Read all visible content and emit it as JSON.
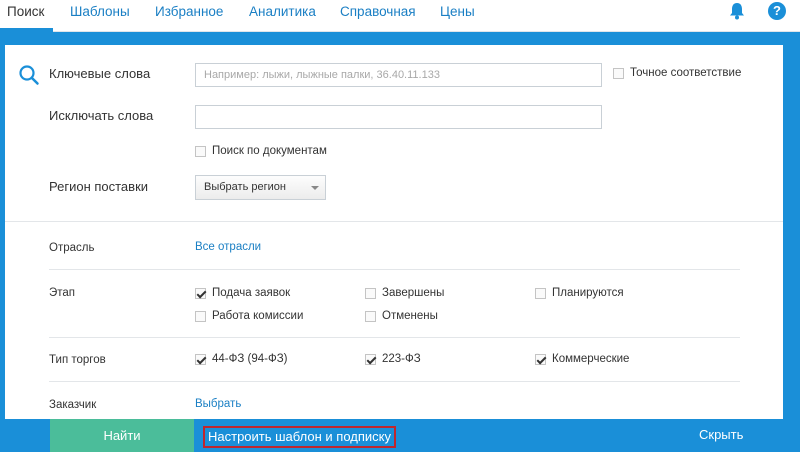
{
  "nav": {
    "tabs": [
      "Поиск",
      "Шаблоны",
      "Избранное",
      "Аналитика",
      "Справочная",
      "Цены"
    ],
    "help": "?",
    "icons": [
      "bell-icon",
      "help-icon"
    ]
  },
  "form": {
    "keywords_label": "Ключевые слова",
    "keywords_placeholder": "Например: лыжи, лыжные палки, 36.40.11.133",
    "keywords_value": "",
    "exact_match": "Точное соответствие",
    "exclude_label": "Исключать слова",
    "exclude_value": "",
    "doc_search": "Поиск по документам",
    "region_label": "Регион поставки",
    "region_select": "Выбрать регион"
  },
  "filters": {
    "industry_label": "Отрасль",
    "industry_link": "Все отрасли",
    "stage_label": "Этап",
    "stages": [
      {
        "label": "Подача заявок",
        "checked": true
      },
      {
        "label": "Завершены",
        "checked": false
      },
      {
        "label": "Планируются",
        "checked": false
      },
      {
        "label": "Работа комиссии",
        "checked": false
      },
      {
        "label": "Отменены",
        "checked": false
      }
    ],
    "type_label": "Тип торгов",
    "types": [
      {
        "label": "44-ФЗ (94-ФЗ)",
        "checked": true
      },
      {
        "label": "223-ФЗ",
        "checked": true
      },
      {
        "label": "Коммерческие",
        "checked": true
      }
    ],
    "customer_label": "Заказчик",
    "customer_link": "Выбрать"
  },
  "actions": {
    "find": "Найти",
    "template": "Настроить шаблон и подписку",
    "hide": "Скрыть"
  },
  "colors": {
    "accent": "#1a8fd8",
    "find_button": "#4bbd9a",
    "highlight_border": "#c0262d"
  }
}
